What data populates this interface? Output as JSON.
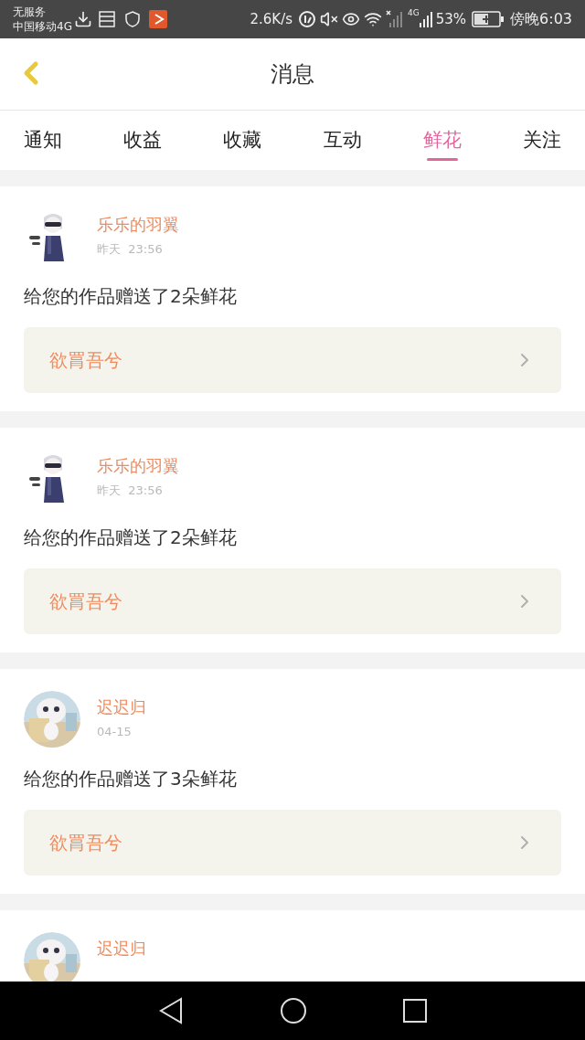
{
  "status_bar": {
    "carrier_line_1": "无服务",
    "carrier_line_2": "中国移动4G",
    "speed": "2.6K/s",
    "network": "4G",
    "battery": "53%",
    "time": "傍晚6:03"
  },
  "header": {
    "title": "消息"
  },
  "tabs": [
    {
      "label": "通知",
      "selected": false
    },
    {
      "label": "收益",
      "selected": false
    },
    {
      "label": "收藏",
      "selected": false
    },
    {
      "label": "互动",
      "selected": false
    },
    {
      "label": "鲜花",
      "selected": true
    },
    {
      "label": "关注",
      "selected": false
    }
  ],
  "messages": [
    {
      "kind": "illustration",
      "name": "乐乐的羽翼",
      "date": "昨天  23:56",
      "text": "给您的作品赠送了2朵鲜花",
      "work": "欲罥吾兮"
    },
    {
      "kind": "illustration",
      "name": "乐乐的羽翼",
      "date": "昨天  23:56",
      "text": "给您的作品赠送了2朵鲜花",
      "work": "欲罥吾兮"
    },
    {
      "name": "迟迟归",
      "date": "04-15",
      "text": "给您的作品赠送了3朵鲜花",
      "work": "欲罥吾兮"
    },
    {
      "name": "迟迟归"
    }
  ]
}
